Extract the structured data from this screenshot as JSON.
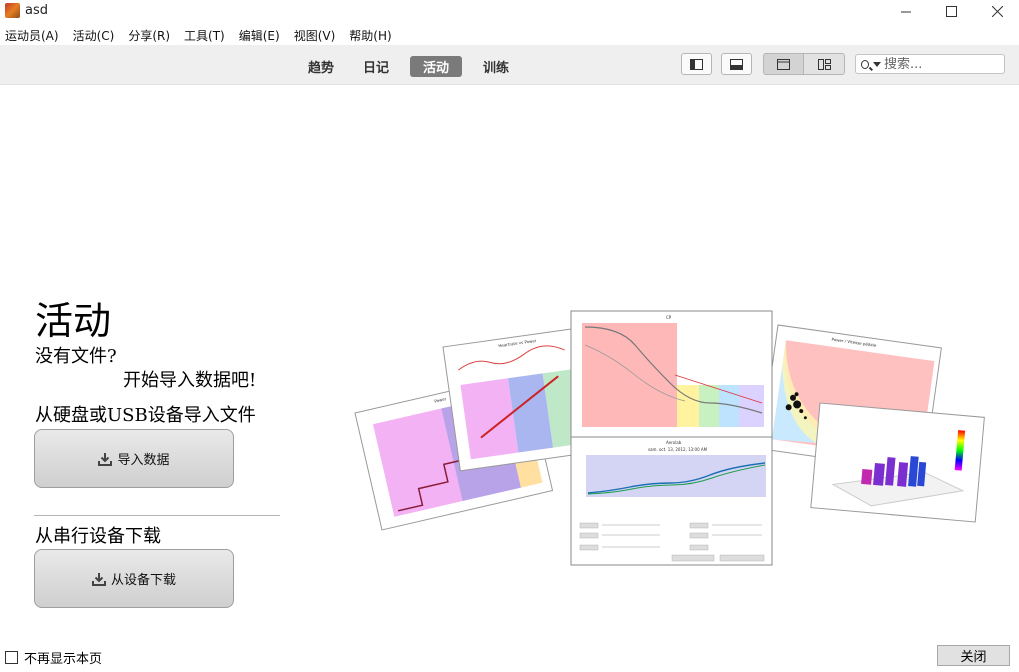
{
  "window": {
    "title": "asd"
  },
  "menu": [
    "运动员(A)",
    "活动(C)",
    "分享(R)",
    "工具(T)",
    "编辑(E)",
    "视图(V)",
    "帮助(H)"
  ],
  "tabs": [
    {
      "label": "趋势",
      "active": false
    },
    {
      "label": "日记",
      "active": false
    },
    {
      "label": "活动",
      "active": true
    },
    {
      "label": "训练",
      "active": false
    }
  ],
  "search": {
    "placeholder": "搜索..."
  },
  "main": {
    "heading": "活动",
    "no_files": "没有文件?",
    "start_import": "开始导入数据吧!",
    "import_section_label": "从硬盘或USB设备导入文件",
    "import_button": "导入数据",
    "download_section_label": "从串行设备下载",
    "download_button": "从设备下载"
  },
  "footer": {
    "dont_show_label": "不再显示本页",
    "dont_show_checked": false,
    "close_button": "关闭"
  },
  "collage": {
    "card_titles": [
      "Power",
      "Heartrate vs Power",
      "CP",
      "Aerolab",
      "Power / Vitesse pédale",
      ""
    ],
    "aerolab_subtitle": "sam. oct. 13, 2012, 13:00 AM"
  },
  "colors": {
    "tab_active_bg": "#7a7a7a",
    "toolbar_bg": "#efefef"
  }
}
